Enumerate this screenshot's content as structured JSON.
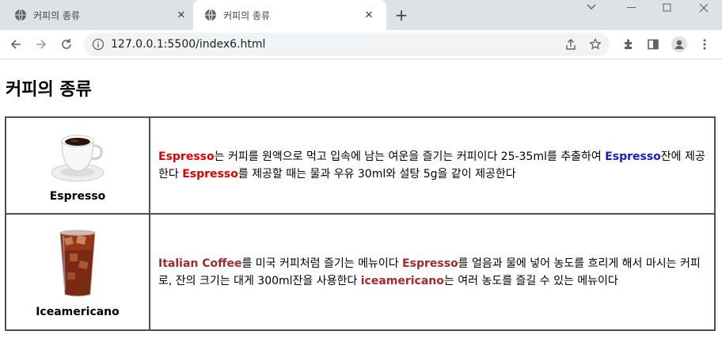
{
  "browser": {
    "tabs": [
      {
        "title": "커피의 종류",
        "active": false
      },
      {
        "title": "커피의 종류",
        "active": true
      }
    ],
    "new_tab_symbol": "+",
    "url": "127.0.0.1:5500/index6.html",
    "window_controls": [
      "chevron-down-icon",
      "minimize-icon",
      "maximize-icon",
      "close-icon"
    ],
    "toolbar_icons": [
      "share-icon",
      "bookmark-star-icon",
      "extensions-icon",
      "sidebar-icon",
      "profile-icon",
      "more-menu-icon"
    ]
  },
  "page": {
    "title": "커피의 종류",
    "rows": [
      {
        "name": "Espresso",
        "image_icon": "espresso-cup-image",
        "desc": [
          {
            "text": "Espresso",
            "style": "red"
          },
          {
            "text": "는 커피를 원액으로 먹고 입속에 남는 여운을 즐기는 커피이다 25-35ml를 추출하여 ",
            "style": "plain"
          },
          {
            "text": "Espresso",
            "style": "blue"
          },
          {
            "text": "잔에 제공한다 ",
            "style": "plain"
          },
          {
            "text": "Espresso",
            "style": "red"
          },
          {
            "text": "를 제공할 때는 물과 우유 30ml와 설탕 5g을 같이 제공한다",
            "style": "plain"
          }
        ]
      },
      {
        "name": "Iceamericano",
        "image_icon": "iced-americano-image",
        "desc": [
          {
            "text": "Italian Coffee",
            "style": "brown"
          },
          {
            "text": "를 미국 커피처럼 즐기는 메뉴이다 ",
            "style": "plain"
          },
          {
            "text": "Espresso",
            "style": "brown"
          },
          {
            "text": "를 얼음과 물에 넣어 농도를 흐리게 해서 마시는 커피로, 잔의 크기는 대게 300ml잔을 사용한다 ",
            "style": "plain"
          },
          {
            "text": "iceamericano",
            "style": "brown"
          },
          {
            "text": "는 여러 농도를 즐길 수 있는 메뉴이다",
            "style": "plain"
          }
        ]
      }
    ]
  },
  "colors": {
    "red_keyword": "#e00000",
    "blue_keyword": "#1a1acc",
    "brown_keyword": "#a52a2a",
    "table_border": "#505050",
    "tabstrip": "#dee1e6"
  }
}
